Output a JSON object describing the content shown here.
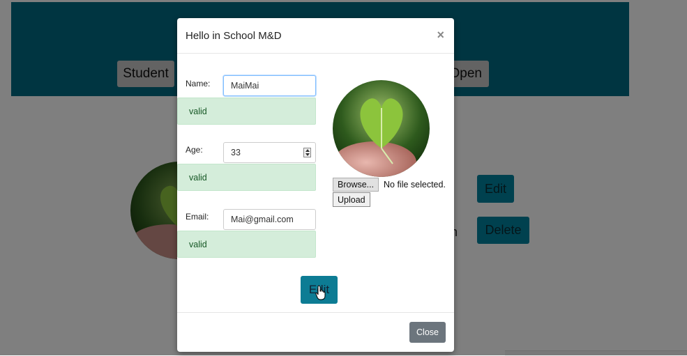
{
  "background": {
    "nav_left_label": "Student",
    "nav_right_label": "Open",
    "row_edit_label": "Edit",
    "row_delete_label": "Delete",
    "row_partial_text": "n"
  },
  "modal": {
    "title": "Hello in School M&D",
    "close_icon": "×",
    "fields": {
      "name": {
        "label": "Name:",
        "value": "MaiMai",
        "feedback": "valid"
      },
      "age": {
        "label": "Age:",
        "value": "33",
        "feedback": "valid"
      },
      "email": {
        "label": "Email:",
        "value": "Mai@gmail.com",
        "feedback": "valid"
      }
    },
    "file": {
      "browse_label": "Browse...",
      "status": "No file selected.",
      "upload_label": "Upload"
    },
    "edit_label": "Edit",
    "close_label": "Close"
  },
  "colors": {
    "header_teal": "#006b82",
    "valid_bg": "#d4edda",
    "valid_text": "#155724",
    "primary_button": "#0d7c94",
    "secondary_button": "#6c757d"
  },
  "icons": [
    "close-icon",
    "number-spinner-icon",
    "hand-pointer-icon"
  ]
}
